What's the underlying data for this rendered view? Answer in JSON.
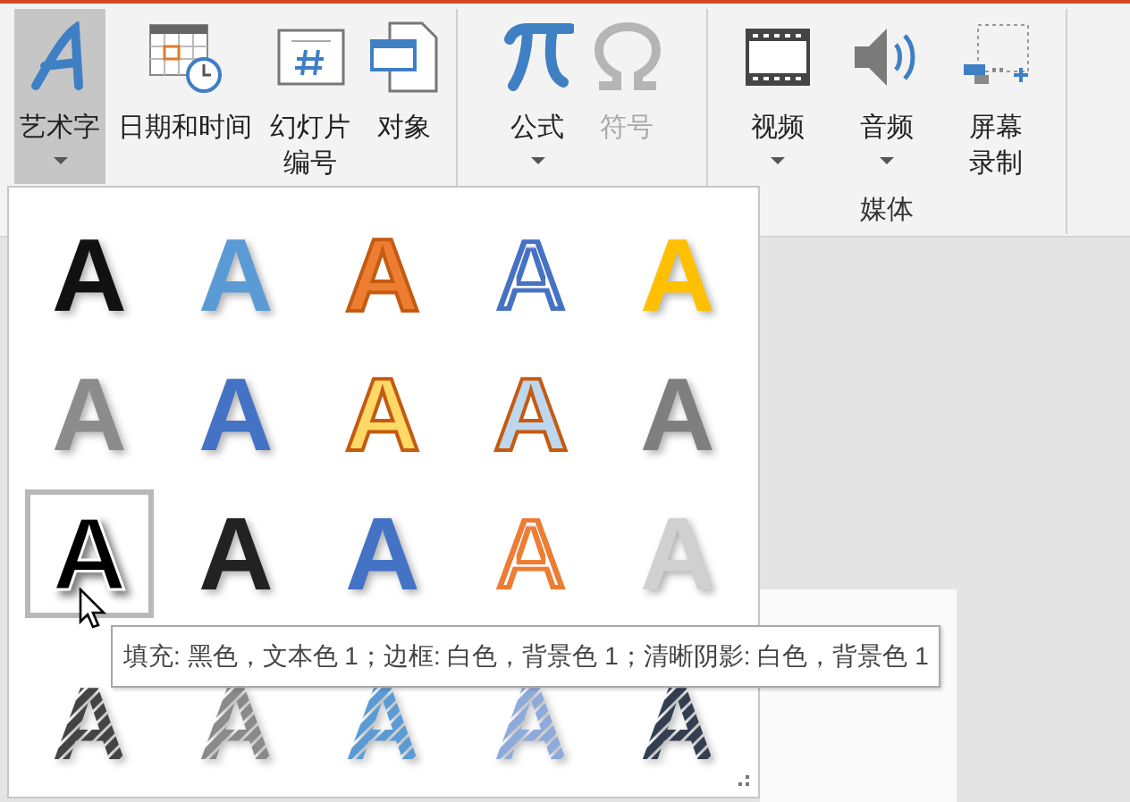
{
  "ribbon": {
    "groups": [
      {
        "buttons": [
          {
            "label_lines": [
              "艺术字"
            ],
            "dropdown": true,
            "selected": true,
            "disabled": false
          },
          {
            "label_lines": [
              "日期和时间"
            ],
            "dropdown": false,
            "selected": false,
            "disabled": false
          },
          {
            "label_lines": [
              "幻灯片",
              "编号"
            ],
            "dropdown": false,
            "selected": false,
            "disabled": false
          },
          {
            "label_lines": [
              "对象"
            ],
            "dropdown": false,
            "selected": false,
            "disabled": false
          }
        ]
      },
      {
        "buttons": [
          {
            "label_lines": [
              "公式"
            ],
            "dropdown": true,
            "selected": false,
            "disabled": false
          },
          {
            "label_lines": [
              "符号"
            ],
            "dropdown": false,
            "selected": false,
            "disabled": true
          }
        ]
      },
      {
        "label": "媒体",
        "buttons": [
          {
            "label_lines": [
              "视频"
            ],
            "dropdown": true,
            "selected": false,
            "disabled": false
          },
          {
            "label_lines": [
              "音频"
            ],
            "dropdown": true,
            "selected": false,
            "disabled": false
          },
          {
            "label_lines": [
              "屏幕",
              "录制"
            ],
            "dropdown": false,
            "selected": false,
            "disabled": false
          }
        ]
      }
    ]
  },
  "wordart_gallery": {
    "styles": [
      {
        "text": "A",
        "kind": "solid",
        "color": "#111111",
        "selected": false
      },
      {
        "text": "A",
        "kind": "solid",
        "color": "#5b9bd5",
        "selected": false
      },
      {
        "text": "A",
        "kind": "filled-outline",
        "color": "#ed7d31",
        "selected": false
      },
      {
        "text": "A",
        "kind": "outline",
        "color": "#4472c4",
        "selected": false
      },
      {
        "text": "A",
        "kind": "solid",
        "color": "#ffc000",
        "selected": false
      },
      {
        "text": "A",
        "kind": "solid",
        "color": "#8c8c8c",
        "selected": false
      },
      {
        "text": "A",
        "kind": "solid",
        "color": "#4472c4",
        "selected": false
      },
      {
        "text": "A",
        "kind": "filled-outline",
        "color": "#ffd966",
        "selected": false
      },
      {
        "text": "A",
        "kind": "filled-outline",
        "color": "#bdd7ee",
        "selected": false
      },
      {
        "text": "A",
        "kind": "solid",
        "color": "#7f7f7f",
        "selected": false
      },
      {
        "text": "A",
        "kind": "solid",
        "color": "#000000",
        "selected": true
      },
      {
        "text": "A",
        "kind": "solid",
        "color": "#222222",
        "selected": false
      },
      {
        "text": "A",
        "kind": "solid",
        "color": "#4472c4",
        "selected": false
      },
      {
        "text": "A",
        "kind": "outline",
        "color": "#ed7d31",
        "selected": false
      },
      {
        "text": "A",
        "kind": "solid",
        "color": "#d0d0d0",
        "selected": false
      },
      {
        "text": "A",
        "kind": "striped",
        "color": "#444444",
        "selected": false
      },
      {
        "text": "A",
        "kind": "striped",
        "color": "#8a8a8a",
        "selected": false
      },
      {
        "text": "A",
        "kind": "striped",
        "color": "#5b9bd5",
        "selected": false
      },
      {
        "text": "A",
        "kind": "striped",
        "color": "#8eaadb",
        "selected": false
      },
      {
        "text": "A",
        "kind": "striped",
        "color": "#333f50",
        "selected": false
      }
    ],
    "tooltip": "填充: 黑色，文本色 1；边框: 白色，背景色 1；清晰阴影: 白色，背景色 1"
  }
}
